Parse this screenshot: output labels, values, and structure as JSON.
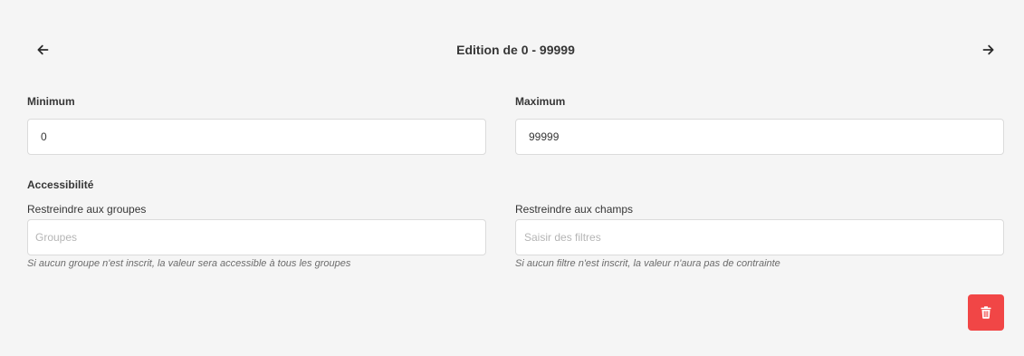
{
  "header": {
    "title": "Edition de 0 - 99999",
    "back_icon": "arrow-left-icon",
    "forward_icon": "arrow-right-icon"
  },
  "range": {
    "minimum_label": "Minimum",
    "minimum_value": "0",
    "maximum_label": "Maximum",
    "maximum_value": "99999"
  },
  "accessibility": {
    "section_title": "Accessibilité",
    "groups": {
      "label": "Restreindre aux groupes",
      "placeholder": "Groupes",
      "help": "Si aucun groupe n'est inscrit, la valeur sera accessible à tous les groupes"
    },
    "fields": {
      "label": "Restreindre aux champs",
      "placeholder": "Saisir des filtres",
      "help": "Si aucun filtre n'est inscrit, la valeur n'aura pas de contrainte"
    }
  },
  "actions": {
    "delete_icon": "trash-icon",
    "delete_color": "#f14646"
  }
}
